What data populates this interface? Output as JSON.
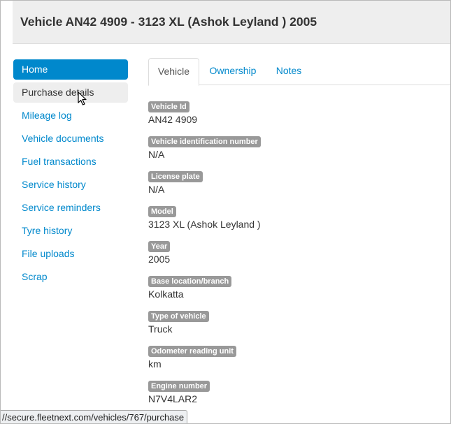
{
  "header": {
    "title": "Vehicle AN42 4909 - 3123 XL (Ashok Leyland ) 2005"
  },
  "sidebar": {
    "items": [
      {
        "label": "Home"
      },
      {
        "label": "Purchase details"
      },
      {
        "label": "Mileage log"
      },
      {
        "label": "Vehicle documents"
      },
      {
        "label": "Fuel transactions"
      },
      {
        "label": "Service history"
      },
      {
        "label": "Service reminders"
      },
      {
        "label": "Tyre history"
      },
      {
        "label": "File uploads"
      },
      {
        "label": "Scrap"
      }
    ]
  },
  "tabs": [
    {
      "label": "Vehicle"
    },
    {
      "label": "Ownership"
    },
    {
      "label": "Notes"
    }
  ],
  "fields": [
    {
      "label": "Vehicle Id",
      "value": "AN42 4909"
    },
    {
      "label": "Vehicle identification number",
      "value": "N/A"
    },
    {
      "label": "License plate",
      "value": "N/A"
    },
    {
      "label": "Model",
      "value": "3123 XL (Ashok Leyland )"
    },
    {
      "label": "Year",
      "value": "2005"
    },
    {
      "label": "Base location/branch",
      "value": "Kolkatta"
    },
    {
      "label": "Type of vehicle",
      "value": "Truck"
    },
    {
      "label": "Odometer reading unit",
      "value": "km"
    },
    {
      "label": "Engine number",
      "value": "N7V4LAR2"
    }
  ],
  "statusbar": {
    "url": "//secure.fleetnext.com/vehicles/767/purchase"
  },
  "colors": {
    "accent": "#0088cc",
    "label_badge": "#999999",
    "header_bg": "#eeeeee"
  },
  "icons": {
    "cursor": "mouse-pointer-icon"
  }
}
